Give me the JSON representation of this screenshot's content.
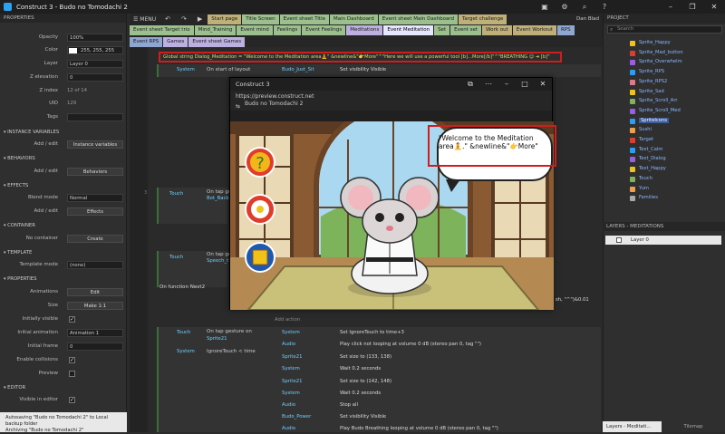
{
  "window": {
    "title": "Construct 3 - Budo no Tomodachi 2"
  },
  "left_panel": {
    "header": "PROPERTIES",
    "rows": [
      {
        "label": "Opacity",
        "value": "100%",
        "type": "input"
      },
      {
        "label": "Color",
        "value": "255, 255, 255",
        "type": "input"
      },
      {
        "label": "Layer",
        "value": "Layer 0",
        "type": "select"
      },
      {
        "label": "Z elevation",
        "value": "0",
        "type": "input"
      },
      {
        "label": "Z index",
        "value": "12 of 14",
        "type": "plain"
      },
      {
        "label": "UID",
        "value": "129",
        "type": "plain"
      },
      {
        "label": "Tags",
        "value": "",
        "type": "input"
      }
    ],
    "sections": {
      "instance_vars": "INSTANCE VARIABLES",
      "behaviors": "BEHAVIORS",
      "effects": "EFFECTS",
      "container": "CONTAINER",
      "template": "TEMPLATE",
      "properties": "PROPERTIES",
      "editor": "EDITOR"
    },
    "add_edit": "Add / edit",
    "instance_vars_btn": "Instance variables",
    "behaviors_btn": "Behaviors",
    "blend_mode_label": "Blend mode",
    "blend_mode_value": "Normal",
    "effects_btn": "Effects",
    "no_container": "No container",
    "create_btn": "Create",
    "template_mode_label": "Template mode",
    "template_mode_value": "(none)",
    "animations_label": "Animations",
    "edit_btn": "Edit",
    "size_label": "Size",
    "size_btn": "Make 1:1",
    "initially_visible": "Initially visible",
    "initial_animation_label": "Initial animation",
    "initial_animation_value": "Animation 1",
    "initial_frame_label": "Initial frame",
    "initial_frame_value": "0",
    "enable_collisions": "Enable collisions",
    "preview_label": "Preview",
    "visible_in_editor": "Visible in editor"
  },
  "status": {
    "line1": "Autosaving \"Budo no Tomodachi 2\" to Local backup folder",
    "line2": "Archiving \"Budo no Tomodachi 2\""
  },
  "toolbar": {
    "menu": "MENU",
    "tabs": [
      "Start page",
      "Title Screen",
      "Event sheet Title",
      "Main Dashboard",
      "Event sheet Main Dashboard",
      "Target challenge"
    ],
    "user": "Dan Blad"
  },
  "tabrow2": [
    "Event sheet Target trio",
    "Mind_Training",
    "Event mind",
    "Feelings",
    "Event Feelings",
    "Meditations",
    "Event Meditation",
    "Set",
    "Event set",
    "Work out",
    "Event Workout",
    "RPS"
  ],
  "tabrow3": [
    "Event RPS",
    "Games",
    "Event sheet Games"
  ],
  "sheet": {
    "global_var": "Global string Dialog_Meditation = \"Welcome to the Meditation area🧘\" &newline&\"👉More\"^\"Here we will use a powerful tool [b]...More[/b]\"^\"BREATHING 😊 ➜ [b]\"",
    "ev1_obj": "System",
    "ev1_cond": "On start of layout",
    "ev1_act_obj": "Budo_Just_Sit",
    "ev1_act": "Set visibility Visible",
    "ev2_obj": "Touch",
    "ev2_cond": "On tap ge",
    "ev2_sub": "Bot_Back",
    "ev3_obj": "Touch",
    "ev3_cond": "On tap ge",
    "ev3_sub": "Speech_t",
    "fn": "On function Next2",
    "add_action": "Add action",
    "ev4_obj1": "Touch",
    "ev4_cond1": "On tap gesture on",
    "ev4_sub1": "Sprite21",
    "ev4_obj2": "System",
    "ev4_cond2": "IgnoreTouch < time",
    "actions": [
      {
        "obj": "System",
        "text": "Set IgnoreTouch to time+3"
      },
      {
        "obj": "Audio",
        "text": "Play click not looping at volume 0 dB (stereo pan 0, tag \"\")"
      },
      {
        "obj": "Sprite21",
        "text": "Set size to (133, 138)"
      },
      {
        "obj": "System",
        "text": "Wait 0.2 seconds"
      },
      {
        "obj": "Sprite21",
        "text": "Set size to (142, 148)"
      },
      {
        "obj": "System",
        "text": "Wait 0.2 seconds"
      },
      {
        "obj": "Audio",
        "text": "Stop all"
      },
      {
        "obj": "Budo_Power",
        "text": "Set visibility Visible"
      },
      {
        "obj": "Audio",
        "text": "Play Budo Breathing looping at volume 0 dB (stereo pan 0, tag \"\")"
      }
    ],
    "right_text": "sh, \"^\")&0.01"
  },
  "right_panel": {
    "header": "PROJECT",
    "search_placeholder": "Search",
    "items": [
      "Sprite_Happy",
      "Sprite_Mad_button",
      "Sprite_Overwhelm",
      "Sprite_RPS",
      "Sprite_RPS2",
      "Sprite_Sad",
      "Sprite_Scroll_Arr",
      "Sprite_Scroll_Med",
      "SpriteIcons",
      "Sushi",
      "Target",
      "Text_Calm",
      "Text_Dialog",
      "Text_Happy",
      "Touch",
      "Yum",
      "Families"
    ],
    "layers_header": "LAYERS - MEDITATIONS",
    "layer0": "Layer 0",
    "bottom_tab1": "Layers - Meditati...",
    "bottom_tab2": "Tilemap"
  },
  "preview": {
    "title": "Construct 3",
    "url": "https://preview.construct.net",
    "game_name": "Budo no Tomodachi 2",
    "bubble_line1": "\"Welcome to the Meditation",
    "bubble_line2": "area🧘.\" &newline&\"👉More\""
  }
}
